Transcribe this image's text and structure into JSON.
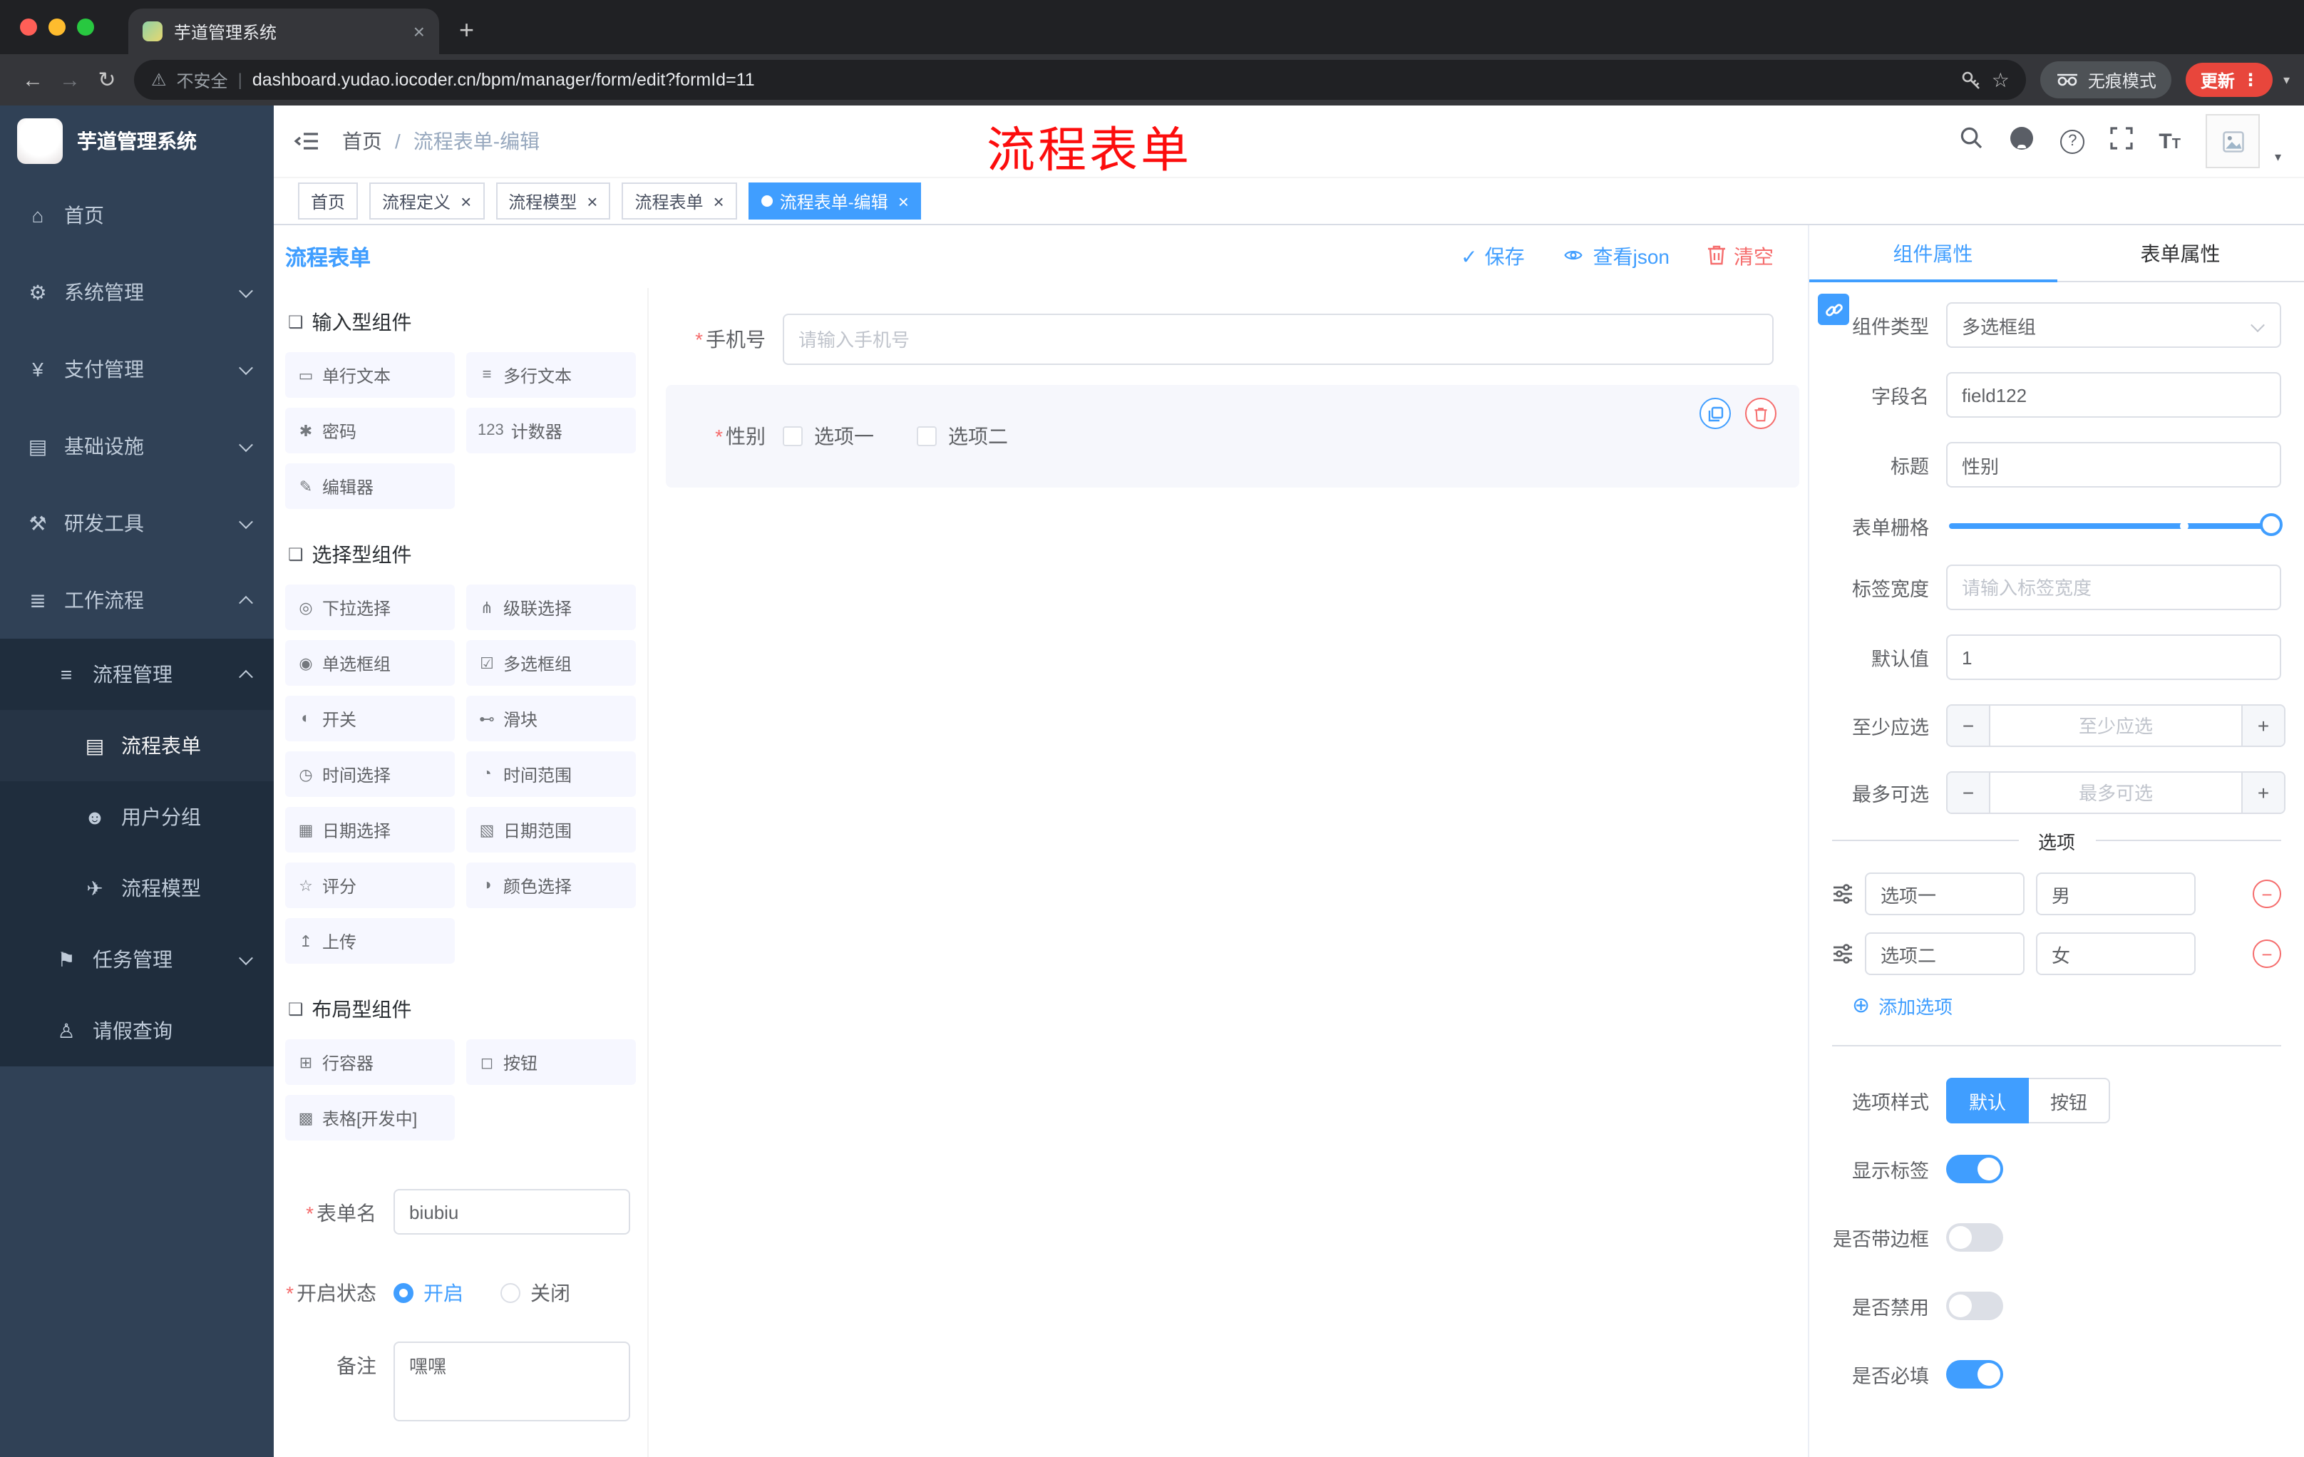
{
  "colors": {
    "primary": "#409eff",
    "danger": "#f56c6c",
    "sidebar": "#304156",
    "submenu": "#1f2d3d",
    "update_button": "#e8463c",
    "annotation_red": "#fc0d0d"
  },
  "icons": {
    "close": "×",
    "plus": "+",
    "back": "←",
    "forward": "→",
    "reload": "↻",
    "warning": "⚠",
    "star": "☆",
    "kebab": "⋮",
    "caret": "▾",
    "check": "✓",
    "minus": "−",
    "plus_small": "+",
    "question": "?",
    "font_size_large": "T",
    "font_size_small": "T",
    "section": "❑",
    "required": "*",
    "divider": "|",
    "add_circle": "⊕",
    "remove": "−"
  },
  "browser": {
    "tab_title": "芋道管理系统",
    "security": "不安全",
    "url": "dashboard.yudao.iocoder.cn/bpm/manager/form/edit?formId=11",
    "incognito": "无痕模式",
    "update": "更新"
  },
  "annotation": "流程表单",
  "sidebar": {
    "title": "芋道管理系统",
    "items": [
      {
        "icon": "⌂",
        "label": "首页"
      },
      {
        "icon": "⚙",
        "label": "系统管理"
      },
      {
        "icon": "¥",
        "label": "支付管理"
      },
      {
        "icon": "▤",
        "label": "基础设施"
      },
      {
        "icon": "⚒",
        "label": "研发工具"
      },
      {
        "icon": "≣",
        "label": "工作流程"
      },
      {
        "icon": "≡",
        "label": "流程管理"
      },
      {
        "icon": "▤",
        "label": "流程表单"
      },
      {
        "icon": "☻",
        "label": "用户分组"
      },
      {
        "icon": "✈",
        "label": "流程模型"
      },
      {
        "icon": "⚑",
        "label": "任务管理"
      },
      {
        "icon": "♙",
        "label": "请假查询"
      }
    ]
  },
  "header": {
    "breadcrumb": {
      "home": "首页",
      "separator": "/",
      "current": "流程表单-编辑"
    }
  },
  "tags": [
    {
      "label": "首页"
    },
    {
      "label": "流程定义"
    },
    {
      "label": "流程模型"
    },
    {
      "label": "流程表单"
    },
    {
      "label": "流程表单-编辑"
    }
  ],
  "designer": {
    "title": "流程表单",
    "actions": {
      "save": "保存",
      "view_json": "查看json",
      "clear": "清空"
    },
    "palette": {
      "input_title": "输入型组件",
      "input": [
        {
          "icon": "▭",
          "label": "单行文本"
        },
        {
          "icon": "≡",
          "label": "多行文本"
        },
        {
          "icon": "✱",
          "label": "密码"
        },
        {
          "icon": "123",
          "label": "计数器"
        },
        {
          "icon": "✎",
          "label": "编辑器"
        }
      ],
      "select_title": "选择型组件",
      "select": [
        {
          "icon": "◎",
          "label": "下拉选择"
        },
        {
          "icon": "⋔",
          "label": "级联选择"
        },
        {
          "icon": "◉",
          "label": "单选框组"
        },
        {
          "icon": "☑",
          "label": "多选框组"
        },
        {
          "icon": "◐",
          "label": "开关"
        },
        {
          "icon": "⊷",
          "label": "滑块"
        },
        {
          "icon": "◷",
          "label": "时间选择"
        },
        {
          "icon": "◔",
          "label": "时间范围"
        },
        {
          "icon": "▦",
          "label": "日期选择"
        },
        {
          "icon": "▧",
          "label": "日期范围"
        },
        {
          "icon": "☆",
          "label": "评分"
        },
        {
          "icon": "◑",
          "label": "颜色选择"
        },
        {
          "icon": "↥",
          "label": "上传"
        }
      ],
      "layout_title": "布局型组件",
      "layout": [
        {
          "icon": "⊞",
          "label": "行容器"
        },
        {
          "icon": "◻",
          "label": "按钮"
        },
        {
          "icon": "▩",
          "label": "表格[开发中]"
        }
      ]
    },
    "settings": {
      "name_label": "表单名",
      "name_value": "biubiu",
      "status_label": "开启状态",
      "status_on": "开启",
      "status_off": "关闭",
      "remark_label": "备注",
      "remark_value": "嘿嘿"
    },
    "canvas": {
      "phone_label": "手机号",
      "phone_placeholder": "请输入手机号",
      "gender_label": "性别",
      "gender_options": [
        {
          "label": "选项一"
        },
        {
          "label": "选项二"
        }
      ]
    }
  },
  "props": {
    "tab_component": "组件属性",
    "tab_form": "表单属性",
    "component_type_label": "组件类型",
    "component_type_value": "多选框组",
    "field_name_label": "字段名",
    "field_name_value": "field122",
    "title_label": "标题",
    "title_value": "性别",
    "grid_label": "表单栅格",
    "label_width_label": "标签宽度",
    "label_width_placeholder": "请输入标签宽度",
    "default_label": "默认值",
    "default_value": "1",
    "min_label": "至少应选",
    "min_placeholder": "至少应选",
    "max_label": "最多可选",
    "max_placeholder": "最多可选",
    "options_title": "选项",
    "options": [
      {
        "name": "选项一",
        "value": "男"
      },
      {
        "name": "选项二",
        "value": "女"
      }
    ],
    "add_option": "添加选项",
    "style_label": "选项样式",
    "style_default": "默认",
    "style_button": "按钮",
    "switch_show_label": "显示标签",
    "switch_border": "是否带边框",
    "switch_disabled": "是否禁用",
    "switch_required": "是否必填"
  }
}
